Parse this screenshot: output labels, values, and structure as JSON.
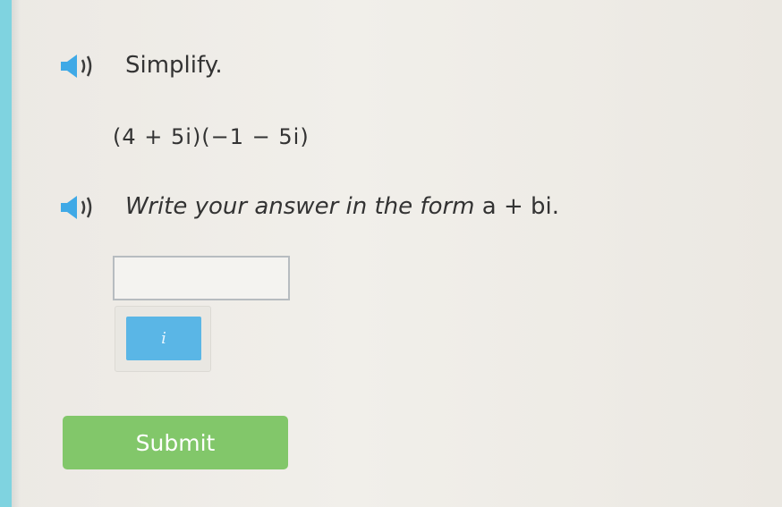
{
  "question": {
    "prompt": "Simplify.",
    "expression": "(4 + 5i)(−1 − 5i)",
    "instruction": "Write your answer in the form",
    "form": "a + bi."
  },
  "answer": {
    "value": ""
  },
  "keypad": {
    "key_i": "i"
  },
  "submit_label": "Submit",
  "colors": {
    "accent_bar": "#7fd3e0",
    "key_blue": "#5ab6e6",
    "submit_green": "#82c76a",
    "speaker_blue": "#3fa9e6"
  },
  "icons": [
    "speaker-icon",
    "speaker-icon"
  ]
}
